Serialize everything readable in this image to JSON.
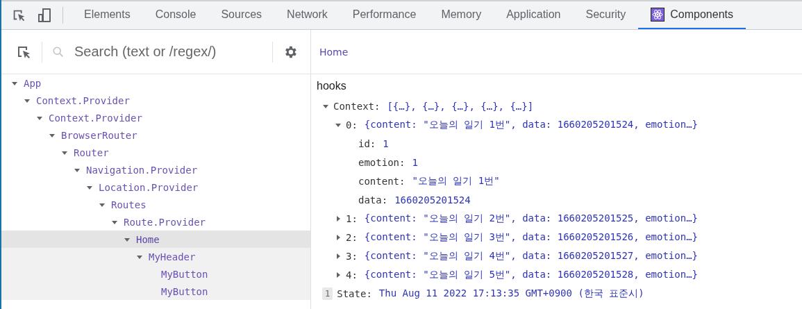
{
  "toolbar": {
    "tabs": [
      {
        "label": "Elements",
        "selected": false,
        "kind": "plain"
      },
      {
        "label": "Console",
        "selected": false,
        "kind": "plain"
      },
      {
        "label": "Sources",
        "selected": false,
        "kind": "plain"
      },
      {
        "label": "Network",
        "selected": false,
        "kind": "plain"
      },
      {
        "label": "Performance",
        "selected": false,
        "kind": "plain"
      },
      {
        "label": "Memory",
        "selected": false,
        "kind": "plain"
      },
      {
        "label": "Application",
        "selected": false,
        "kind": "plain"
      },
      {
        "label": "Security",
        "selected": false,
        "kind": "plain"
      },
      {
        "label": "Components",
        "selected": true,
        "kind": "react"
      }
    ]
  },
  "search": {
    "placeholder": "Search (text or /regex/)"
  },
  "tree": [
    {
      "name": "App",
      "expanded": true,
      "selected": false,
      "children": [
        {
          "name": "Context.Provider",
          "expanded": true,
          "selected": false,
          "children": [
            {
              "name": "Context.Provider",
              "expanded": true,
              "selected": false,
              "children": [
                {
                  "name": "BrowserRouter",
                  "expanded": true,
                  "selected": false,
                  "children": [
                    {
                      "name": "Router",
                      "expanded": true,
                      "selected": false,
                      "children": [
                        {
                          "name": "Navigation.Provider",
                          "expanded": true,
                          "selected": false,
                          "children": [
                            {
                              "name": "Location.Provider",
                              "expanded": true,
                              "selected": false,
                              "children": [
                                {
                                  "name": "Routes",
                                  "expanded": true,
                                  "selected": false,
                                  "children": [
                                    {
                                      "name": "Route.Provider",
                                      "expanded": true,
                                      "selected": false,
                                      "children": [
                                        {
                                          "name": "Home",
                                          "expanded": true,
                                          "selected": true,
                                          "children": [
                                            {
                                              "name": "MyHeader",
                                              "expanded": true,
                                              "selected": false,
                                              "children": [
                                                {
                                                  "name": "MyButton",
                                                  "selected": false
                                                },
                                                {
                                                  "name": "MyButton",
                                                  "selected": false
                                                }
                                              ]
                                            }
                                          ]
                                        }
                                      ]
                                    }
                                  ]
                                }
                              ]
                            }
                          ]
                        }
                      ]
                    }
                  ]
                }
              ]
            }
          ]
        }
      ]
    }
  ],
  "breadcrumb": "Home",
  "hooks": {
    "title": "hooks",
    "items": [
      {
        "key": "Context:",
        "value": "[{…}, {…}, {…}, {…}, {…}]",
        "expanded": true,
        "children": [
          {
            "key": "0:",
            "value": "{content: \"오늘의 일기 1번\", data: 1660205201524, emotion…}",
            "expanded": true,
            "children": [
              {
                "key": "id:",
                "value": "1"
              },
              {
                "key": "emotion:",
                "value": "1"
              },
              {
                "key": "content:",
                "value": "\"오늘의 일기 1번\""
              },
              {
                "key": "data:",
                "value": "1660205201524"
              }
            ]
          },
          {
            "key": "1:",
            "value": "{content: \"오늘의 일기 2번\", data: 1660205201525, emotion…}",
            "expanded": false
          },
          {
            "key": "2:",
            "value": "{content: \"오늘의 일기 3번\", data: 1660205201526, emotion…}",
            "expanded": false
          },
          {
            "key": "3:",
            "value": "{content: \"오늘의 일기 4번\", data: 1660205201527, emotion…}",
            "expanded": false
          },
          {
            "key": "4:",
            "value": "{content: \"오늘의 일기 5번\", data: 1660205201528, emotion…}",
            "expanded": false
          }
        ]
      },
      {
        "badge": "1",
        "key": "State:",
        "value": "Thu Aug 11 2022 17:13:35 GMT+0900 (한국 표준시)"
      }
    ]
  }
}
